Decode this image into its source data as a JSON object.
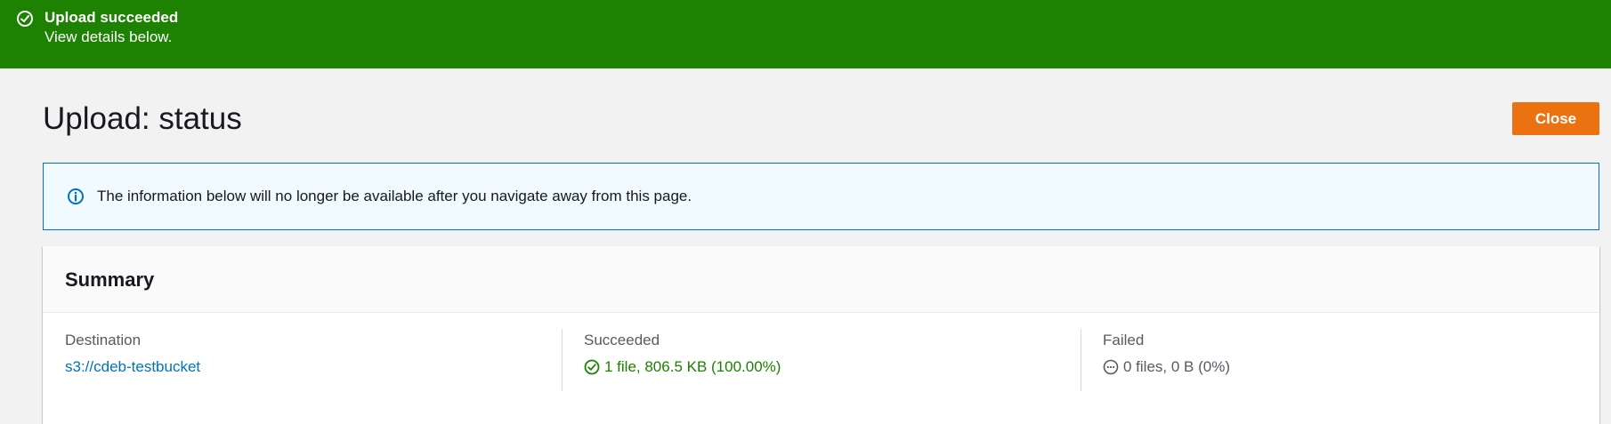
{
  "flash": {
    "title": "Upload succeeded",
    "message": "View details below.",
    "icon": "check-circle-icon",
    "background": "#1d8102"
  },
  "header": {
    "title": "Upload: status",
    "close_label": "Close",
    "close_color": "#ec7211"
  },
  "info_alert": {
    "icon": "info-icon",
    "text": "The information below will no longer be available after you navigate away from this page."
  },
  "summary": {
    "title": "Summary",
    "destination": {
      "label": "Destination",
      "value": "s3://cdeb-testbucket"
    },
    "succeeded": {
      "label": "Succeeded",
      "value": "1 file, 806.5 KB (100.00%)",
      "icon": "check-circle-icon",
      "color": "#1d8102"
    },
    "failed": {
      "label": "Failed",
      "value": "0 files, 0 B (0%)",
      "icon": "ellipsis-circle-icon",
      "color": "#545b64"
    }
  }
}
